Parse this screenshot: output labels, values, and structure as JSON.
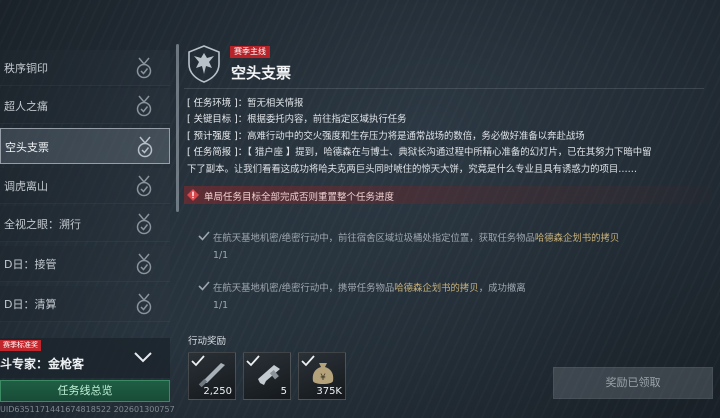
{
  "missions": [
    {
      "label": "秩序铜印"
    },
    {
      "label": "超人之痛"
    },
    {
      "label": "空头支票"
    },
    {
      "label": "调虎离山"
    },
    {
      "label": "全视之眼：溯行"
    },
    {
      "label": "D日：接管"
    },
    {
      "label": "D日：清算"
    }
  ],
  "selected_index": 2,
  "specialist": {
    "tag": "赛季标准奖",
    "name": "斗专家：金枪客"
  },
  "overview_button": "任务线总览",
  "uid": "UID6351171441674818522 202601300757",
  "detail": {
    "tag": "赛季主线",
    "title": "空头支票",
    "env_key": "[ 任务环境 ]：",
    "env_val": "暂无相关情报",
    "target_key": "[ 关键目标 ]：",
    "target_val": "根据委托内容，前往指定区域执行任务",
    "intensity_key": "[ 预计强度 ]：",
    "intensity_val": "高难行动中的交火强度和生存压力将是通常战场的数倍，务必做好准备以奔赴战场",
    "brief_key": "[ 任务简报 ]：",
    "brief_line1": "【 猎户座 】提到，哈德森在与博士、典狱长沟通过程中所精心准备的幻灯片，已在其努力下暗中留",
    "brief_line2": "下了副本。让我们看看这成功将哈夫克两巨头同时唬住的惊天大饼，究竟是什么专业且具有诱惑力的项目……",
    "warning": "单局任务目标全部完成否则重置整个任务进度"
  },
  "objectives": [
    {
      "pre": "在航天基地机密/绝密行动中，前往宿舍区域垃圾桶处指定位置，获取任务物品",
      "item": "哈德森企划书的拷贝",
      "post": "",
      "progress": "1/1"
    },
    {
      "pre": "在航天基地机密/绝密行动中，携带任务物品",
      "item": "哈德森企划书的拷贝",
      "post": "，成功撤离",
      "progress": "1/1"
    }
  ],
  "rewards_label": "行动奖励",
  "rewards": [
    {
      "icon": "knife-weapon-icon",
      "qty": "2,250"
    },
    {
      "icon": "pistol-weapon-icon",
      "qty": "5"
    },
    {
      "icon": "money-bag-icon",
      "qty": "375K"
    }
  ],
  "claimed_button": "奖励已领取",
  "colors": {
    "accent_red": "#b8232a",
    "accent_green": "#1f5e44",
    "gold_text": "#c9b27a"
  }
}
